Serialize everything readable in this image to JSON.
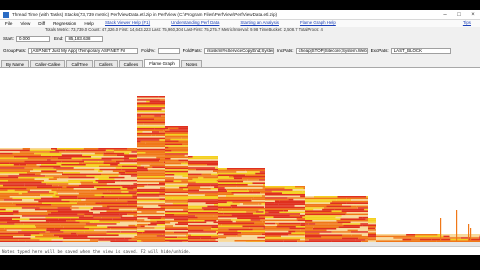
{
  "window": {
    "title": "Thread Time (with Tasks) Stacks(73,739 metric) PerfViewData.etl.zip in PerfView (C:\\Program Files\\PerfView\\PerfViewData.etl.zip)"
  },
  "menu": {
    "items": [
      "File",
      "View",
      "Diff",
      "Regression",
      "Help"
    ],
    "links": [
      "Stack Viewer Help (F1)",
      "Understanding Perf Data",
      "Starting an Analysis",
      "Flame Graph Help"
    ],
    "help_link": "Tips"
  },
  "stats": "Totals Metric: 73,739.0  Count: 47,326.0  First: 14,643.223  Last: 75,960,304  Last-First: 75,275.7  Metric/Interval: 9.98  TimeBucket: 2,508.7  TotalProcs: 4",
  "row1": {
    "start_label": "Start:",
    "start_value": "0.000",
    "end_label": "End:",
    "end_value": "85,183.638"
  },
  "row2": {
    "group_label": "GroupPats:",
    "group_value": "[ASP.NET Just My App] \\Temporary ASP.NET Fil",
    "fold_label": "Fold%:",
    "fold_value": "",
    "foldpats_label": "FoldPats:",
    "foldpats_value": "ntoskrnl!%ServiceCopyEnd;System.Ir",
    "inc_label": "IncPats:",
    "inc_value": "cheap|STOP|Sitecore;System.Web;",
    "exc_label": "ExcPats:",
    "exc_value": "LAST_BLOCK"
  },
  "tabs": [
    "By Name",
    "Caller-Callee",
    "CallTree",
    "Callers",
    "Callees",
    "Flame Graph",
    "Notes"
  ],
  "active_tab": "Flame Graph",
  "notes_text": "Notes typed here will be saved when the view is saved. F2 will hide/unhide.",
  "colors": {
    "flame_red": "#e0301e",
    "flame_orange": "#f07818",
    "flame_yellow": "#f4d020",
    "flame_pale": "#f8d898"
  }
}
